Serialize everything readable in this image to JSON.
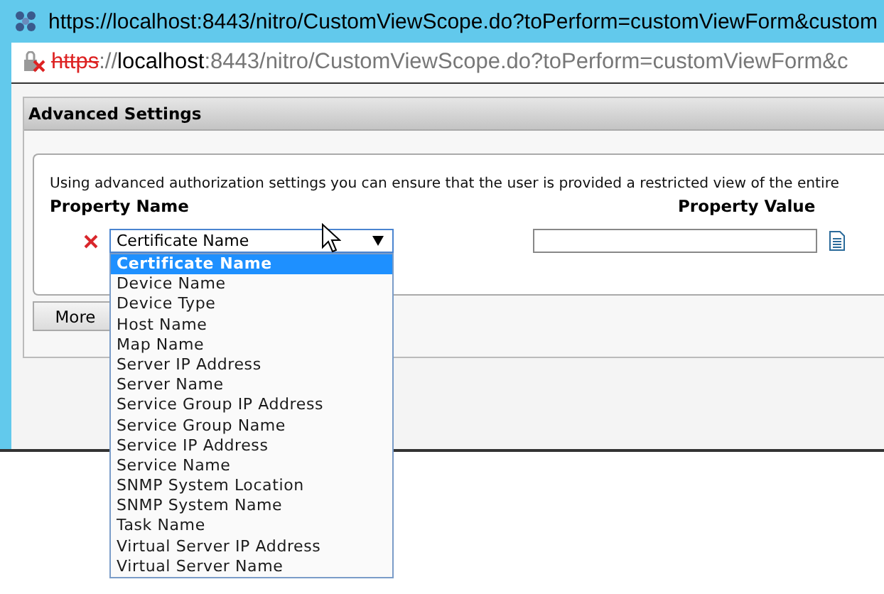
{
  "window": {
    "title": "https://localhost:8443/nitro/CustomViewScope.do?toPerform=customViewForm&custom"
  },
  "address_bar": {
    "scheme": "https",
    "separator": "://",
    "host": "localhost",
    "path": ":8443/nitro/CustomViewScope.do?toPerform=customViewForm&c"
  },
  "panel": {
    "title": "Advanced Settings",
    "description": "Using advanced authorization settings you can ensure that the user is provided a restricted view of the entire",
    "columns": [
      "Property Name",
      "Property Value"
    ],
    "rows": [
      {
        "property": "Certificate Name",
        "value": "",
        "expanded": true
      }
    ],
    "options": [
      {
        "label": "Certificate Name",
        "selected": true
      },
      {
        "label": "Device Name",
        "selected": false
      },
      {
        "label": "Device Type",
        "selected": false
      },
      {
        "label": "Host Name",
        "selected": false
      },
      {
        "label": "Map Name",
        "selected": false
      },
      {
        "label": "Server IP Address",
        "selected": false
      },
      {
        "label": "Server Name",
        "selected": false
      },
      {
        "label": "Service Group IP Address",
        "selected": false
      },
      {
        "label": "Service Group Name",
        "selected": false
      },
      {
        "label": "Service IP Address",
        "selected": false
      },
      {
        "label": "Service Name",
        "selected": false
      },
      {
        "label": "SNMP System Location",
        "selected": false
      },
      {
        "label": "SNMP System Name",
        "selected": false
      },
      {
        "label": "Task Name",
        "selected": false
      },
      {
        "label": "Virtual Server IP Address",
        "selected": false
      },
      {
        "label": "Virtual Server Name",
        "selected": false
      }
    ],
    "more_button": "More"
  }
}
